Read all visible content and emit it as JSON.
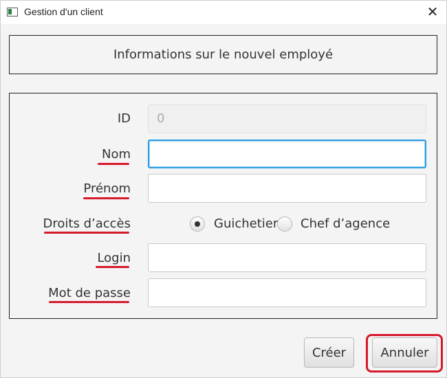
{
  "window": {
    "title": "Gestion d'un client",
    "close_glyph": "✕"
  },
  "header": {
    "text": "Informations sur le nouvel employé"
  },
  "form": {
    "id": {
      "label": "ID",
      "value": "0"
    },
    "nom": {
      "label": "Nom",
      "value": ""
    },
    "prenom": {
      "label": "Prénom",
      "value": ""
    },
    "droits": {
      "label": "Droits d’accès",
      "options": [
        "Guichetier",
        "Chef d’agence"
      ],
      "selected": "Guichetier"
    },
    "login": {
      "label": "Login",
      "value": ""
    },
    "mot_de_passe": {
      "label": "Mot de passe",
      "value": ""
    }
  },
  "buttons": {
    "create": "Créer",
    "cancel": "Annuler"
  },
  "colors": {
    "annotation": "#d6182b",
    "focus": "#2a9ee0"
  }
}
